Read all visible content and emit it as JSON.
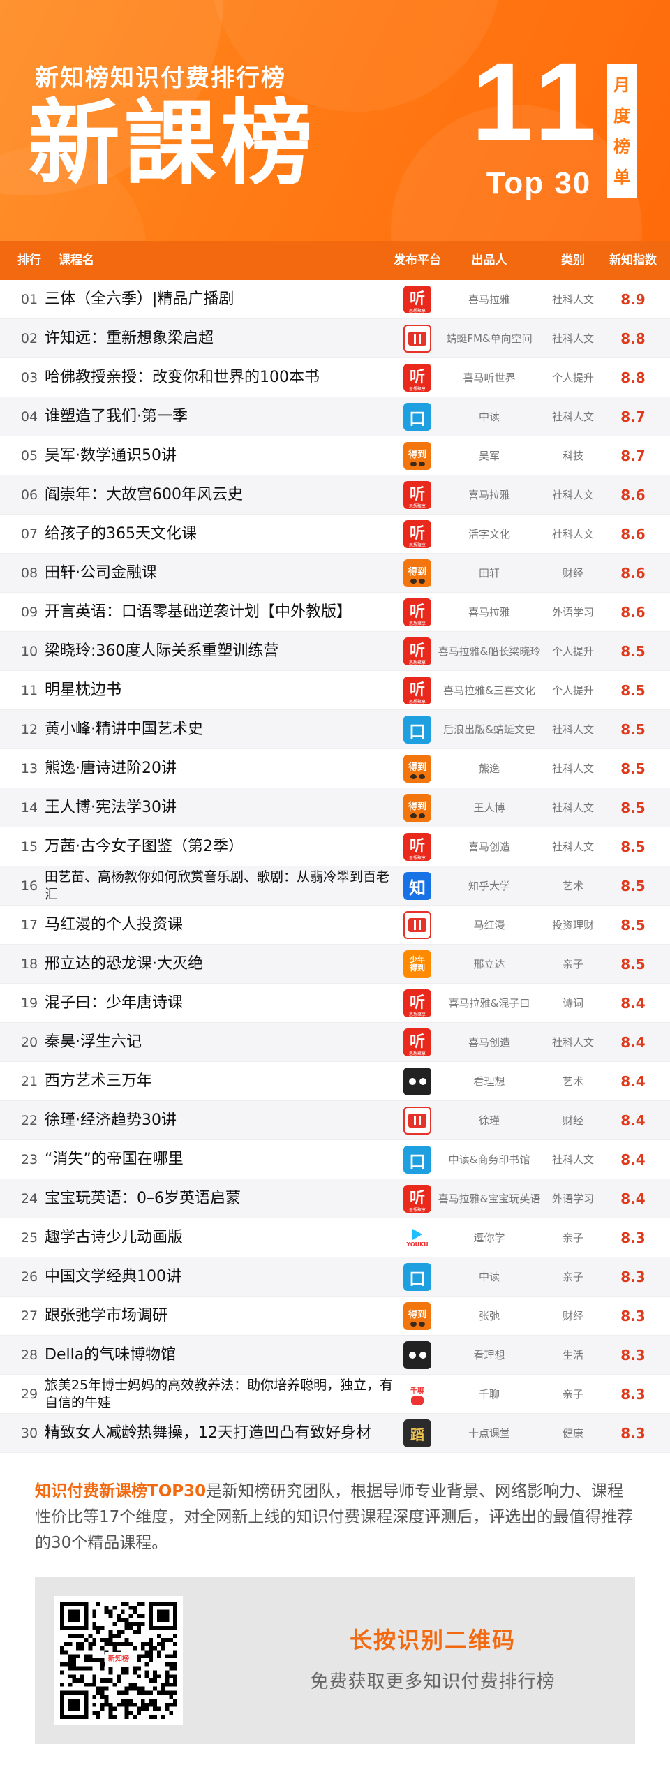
{
  "header": {
    "subtitle": "新知榜知识付费排行榜",
    "title": "新課榜",
    "month": "11",
    "top_label": "Top 30",
    "tag_chars": [
      "月",
      "度",
      "榜",
      "单"
    ]
  },
  "table": {
    "columns": {
      "rank": "排行",
      "name": "课程名",
      "platform": "发布平台",
      "publisher": "出品人",
      "category": "类别",
      "score": "新知指数"
    },
    "rows": [
      {
        "rank": "01",
        "name": "三体（全六季）|精品广播剧",
        "platform_icon": "ting-icon",
        "publisher": "喜马拉雅",
        "category": "社科人文",
        "score": "8.9"
      },
      {
        "rank": "02",
        "name": "许知远：重新想象梁启超",
        "platform_icon": "qingting-icon",
        "publisher": "蜻蜓FM&单向空间",
        "category": "社科人文",
        "score": "8.8"
      },
      {
        "rank": "03",
        "name": "哈佛教授亲授：改变你和世界的100本书",
        "platform_icon": "ting-icon",
        "publisher": "喜马听世界",
        "category": "个人提升",
        "score": "8.8"
      },
      {
        "rank": "04",
        "name": "谁塑造了我们·第一季",
        "platform_icon": "zhongdu-icon",
        "publisher": "中读",
        "category": "社科人文",
        "score": "8.7"
      },
      {
        "rank": "05",
        "name": "吴军·数学通识50讲",
        "platform_icon": "dedao-icon",
        "publisher": "吴军",
        "category": "科技",
        "score": "8.7"
      },
      {
        "rank": "06",
        "name": "阎崇年：大故宫600年风云史",
        "platform_icon": "ting-icon",
        "publisher": "喜马拉雅",
        "category": "社科人文",
        "score": "8.6"
      },
      {
        "rank": "07",
        "name": "给孩子的365天文化课",
        "platform_icon": "ting-icon",
        "publisher": "活字文化",
        "category": "社科人文",
        "score": "8.6"
      },
      {
        "rank": "08",
        "name": "田轩·公司金融课",
        "platform_icon": "dedao-icon",
        "publisher": "田轩",
        "category": "财经",
        "score": "8.6"
      },
      {
        "rank": "09",
        "name": "开言英语：口语零基础逆袭计划【中外教版】",
        "platform_icon": "ting-icon",
        "publisher": "喜马拉雅",
        "category": "外语学习",
        "score": "8.6"
      },
      {
        "rank": "10",
        "name": "梁晓玲:360度人际关系重塑训练营",
        "platform_icon": "ting-icon",
        "publisher": "喜马拉雅&船长梁晓玲",
        "category": "个人提升",
        "score": "8.5"
      },
      {
        "rank": "11",
        "name": "明星枕边书",
        "platform_icon": "ting-icon",
        "publisher": "喜马拉雅&三喜文化",
        "category": "个人提升",
        "score": "8.5"
      },
      {
        "rank": "12",
        "name": "黄小峰·精讲中国艺术史",
        "platform_icon": "zhongdu-icon",
        "publisher": "后浪出版&蜻蜓文史",
        "category": "社科人文",
        "score": "8.5"
      },
      {
        "rank": "13",
        "name": "熊逸·唐诗进阶20讲",
        "platform_icon": "dedao-icon",
        "publisher": "熊逸",
        "category": "社科人文",
        "score": "8.5"
      },
      {
        "rank": "14",
        "name": "王人博·宪法学30讲",
        "platform_icon": "dedao-icon",
        "publisher": "王人博",
        "category": "社科人文",
        "score": "8.5"
      },
      {
        "rank": "15",
        "name": "万茜·古今女子图鉴（第2季）",
        "platform_icon": "ting-icon",
        "publisher": "喜马创造",
        "category": "社科人文",
        "score": "8.5"
      },
      {
        "rank": "16",
        "name": "田艺苗、高杨教你如何欣赏音乐剧、歌剧：从翡冷翠到百老汇",
        "platform_icon": "zhihu-icon",
        "publisher": "知乎大学",
        "category": "艺术",
        "score": "8.5",
        "small": true
      },
      {
        "rank": "17",
        "name": "马红漫的个人投资课",
        "platform_icon": "qingting-icon",
        "publisher": "马红漫",
        "category": "投资理财",
        "score": "8.5"
      },
      {
        "rank": "18",
        "name": "邢立达的恐龙课·大灭绝",
        "platform_icon": "shaonian-icon",
        "publisher": "邢立达",
        "category": "亲子",
        "score": "8.5"
      },
      {
        "rank": "19",
        "name": "混子曰：少年唐诗课",
        "platform_icon": "ting-icon",
        "publisher": "喜马拉雅&混子曰",
        "category": "诗词",
        "score": "8.4"
      },
      {
        "rank": "20",
        "name": "秦昊·浮生六记",
        "platform_icon": "ting-icon",
        "publisher": "喜马创造",
        "category": "社科人文",
        "score": "8.4"
      },
      {
        "rank": "21",
        "name": "西方艺术三万年",
        "platform_icon": "kanlixiang-icon",
        "publisher": "看理想",
        "category": "艺术",
        "score": "8.4"
      },
      {
        "rank": "22",
        "name": "徐瑾·经济趋势30讲",
        "platform_icon": "qingting-icon",
        "publisher": "徐瑾",
        "category": "财经",
        "score": "8.4"
      },
      {
        "rank": "23",
        "name": "“消失”的帝国在哪里",
        "platform_icon": "zhongdu-icon",
        "publisher": "中读&商务印书馆",
        "category": "社科人文",
        "score": "8.4"
      },
      {
        "rank": "24",
        "name": "宝宝玩英语：0–6岁英语启蒙",
        "platform_icon": "ting-icon",
        "publisher": "喜马拉雅&宝宝玩英语",
        "category": "外语学习",
        "score": "8.4"
      },
      {
        "rank": "25",
        "name": "趣学古诗少儿动画版",
        "platform_icon": "youku-icon",
        "publisher": "逗你学",
        "category": "亲子",
        "score": "8.3"
      },
      {
        "rank": "26",
        "name": "中国文学经典100讲",
        "platform_icon": "zhongdu-icon",
        "publisher": "中读",
        "category": "亲子",
        "score": "8.3"
      },
      {
        "rank": "27",
        "name": "跟张弛学市场调研",
        "platform_icon": "dedao-icon",
        "publisher": "张弛",
        "category": "财经",
        "score": "8.3"
      },
      {
        "rank": "28",
        "name": "Della的气味博物馆",
        "platform_icon": "kanlixiang-icon",
        "publisher": "看理想",
        "category": "生活",
        "score": "8.3"
      },
      {
        "rank": "29",
        "name": "旅美25年博士妈妈的高效教养法：助你培养聪明，独立，有自信的牛娃",
        "platform_icon": "qianliao-icon",
        "publisher": "千聊",
        "category": "亲子",
        "score": "8.3",
        "small": true
      },
      {
        "rank": "30",
        "name": "精致女人减龄热舞操，12天打造凹凸有致好身材",
        "platform_icon": "shidian-icon",
        "publisher": "十点课堂",
        "category": "健康",
        "score": "8.3"
      }
    ]
  },
  "footer": {
    "desc_highlight": "知识付费新课榜TOP30",
    "desc_rest": "是新知榜研究团队，根据导师专业背景、网络影响力、课程性价比等17个维度，对全网新上线的知识付费课程深度评测后，评选出的最值得推荐的30个精品课程。",
    "qr_title": "长按识别二维码",
    "qr_subtitle": "免费获取更多知识付费排行榜"
  }
}
